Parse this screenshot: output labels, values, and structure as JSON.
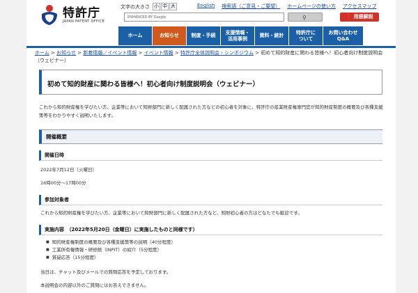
{
  "header": {
    "logo_name": "特許庁",
    "logo_en": "JAPAN PATENT OFFICE",
    "font_size_label": "文字の大きさ",
    "font_sizes": [
      "小",
      "中",
      "大"
    ],
    "top_links": [
      "English",
      "検索語（ご意見・ご要望）",
      "ホームページの使い方",
      "アクセスマップ"
    ],
    "search_placeholder": "ENHANCED BY Google",
    "search_button_icon": "search-icon",
    "glossary_label": "用語解説"
  },
  "nav": {
    "items": [
      {
        "label": "ホーム"
      },
      {
        "label": "お知らせ"
      },
      {
        "label": "制度・手続"
      },
      {
        "label": "支援情報・\n活用事例"
      },
      {
        "label": "資料・統計"
      },
      {
        "label": "特許庁に\nついて"
      },
      {
        "label": "お問い合わせ\nQ&A"
      }
    ],
    "active_index": 1,
    "colors": {
      "primary": "#1b5fa6",
      "active": "#d05a1e"
    }
  },
  "breadcrumb": {
    "links": [
      "ホーム",
      "お知らせ",
      "新着情報／イベント情報",
      "イベント情報",
      "特許庁全体説明会・シンポジウム"
    ],
    "current": "初めて知的財産に関わる皆様へ！初心者向け制度説明会（ウェビナー）"
  },
  "page": {
    "title": "初めて知的財産に関わる皆様へ！初心者向け制度説明会（ウェビナー）",
    "intro": "これから知的財産権を学びたい方、企業等において知財部門に新しく配属された方などの初心者を対象に、特許庁の産業財産権専門官が知的財産制度の概要及び各種支援策等をわかりやすく説明いたします。",
    "section_overview": "開催概要",
    "date_heading": "開催日時",
    "date_value": "2022年7月12日（火曜日）",
    "time_value": "16時00分～17時00分",
    "target_heading": "参加対象者",
    "target_value": "これから知的財産権を学びたい方、企業等において知財部門に新しく配属された方など、知財初心者の方はどなたでも歓迎です。",
    "content_heading": "実施内容　（2022年5月20日（金曜日）に実施したものと同様です）",
    "content_items": [
      "知的財産権制度の概要及び各種支援策等の説明（40分程度）",
      "工業所有権情報・研修館（INPIT）の紹介（5分程度）",
      "質疑応答（15分程度）"
    ],
    "note1": "当日は、チャット及びメールでの質問応答を予定しております。",
    "note2": "本説明会の内容以外のご質問にはお答えできません。"
  }
}
